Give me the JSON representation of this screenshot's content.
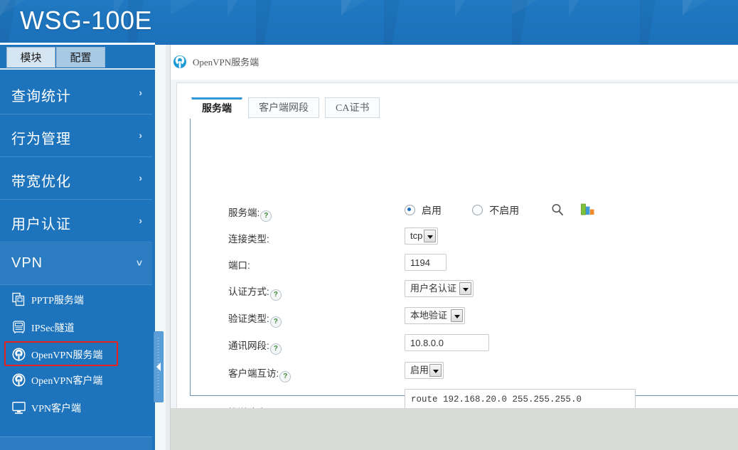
{
  "header": {
    "brand": "WSG-100E"
  },
  "sidebar": {
    "mode_tabs": [
      {
        "label": "模块",
        "active": true
      },
      {
        "label": "配置",
        "active": false
      }
    ],
    "groups": [
      {
        "label": "查询统计",
        "arrow": "›",
        "expanded": false
      },
      {
        "label": "行为管理",
        "arrow": "›",
        "expanded": false
      },
      {
        "label": "带宽优化",
        "arrow": "›",
        "expanded": false
      },
      {
        "label": "用户认证",
        "arrow": "›",
        "expanded": false
      },
      {
        "label": "VPN",
        "arrow": "˅",
        "expanded": true
      }
    ],
    "items": [
      {
        "label": "PPTP服务端",
        "icon": "pages-icon",
        "selected": false
      },
      {
        "label": "IPSec隧道",
        "icon": "tunnel-icon",
        "selected": false
      },
      {
        "label": "OpenVPN服务端",
        "icon": "openvpn-icon",
        "selected": true
      },
      {
        "label": "OpenVPN客户端",
        "icon": "openvpn-icon",
        "selected": false
      },
      {
        "label": "VPN客户端",
        "icon": "monitor-icon",
        "selected": false
      }
    ]
  },
  "page": {
    "title": "OpenVPN服务端",
    "title_icon": "openvpn-icon",
    "tabs": [
      {
        "label": "服务端",
        "active": true
      },
      {
        "label": "客户端网段",
        "active": false
      },
      {
        "label": "CA证书",
        "active": false
      }
    ],
    "toolbar_icons": [
      {
        "name": "search-icon"
      },
      {
        "name": "bar-chart-icon"
      }
    ],
    "form": {
      "service": {
        "label": "服务端:",
        "help": "?",
        "options": [
          {
            "label": "启用",
            "selected": true
          },
          {
            "label": "不启用",
            "selected": false
          }
        ]
      },
      "conn_type": {
        "label": "连接类型:",
        "help": "",
        "value": "tcp"
      },
      "port": {
        "label": "端口:",
        "help": "",
        "value": "1194"
      },
      "auth_method": {
        "label": "认证方式:",
        "help": "?",
        "value": "用户名认证"
      },
      "verify_type": {
        "label": "验证类型:",
        "help": "?",
        "value": "本地验证"
      },
      "subnet": {
        "label": "通讯网段:",
        "help": "?",
        "value": "10.8.0.0"
      },
      "client_to_client": {
        "label": "客户端互访:",
        "help": "?",
        "value": "启用"
      },
      "push_route": {
        "label": "推送路由:",
        "help": "?",
        "value": "route 192.168.20.0 255.255.255.0"
      }
    }
  },
  "colors": {
    "brand_blue": "#1d74bd",
    "sidebar_blue": "#1d74bd",
    "selected_outline": "#e8211c",
    "tab_active_top": "#2f97d8",
    "page_bg": "#d9dbd7"
  }
}
